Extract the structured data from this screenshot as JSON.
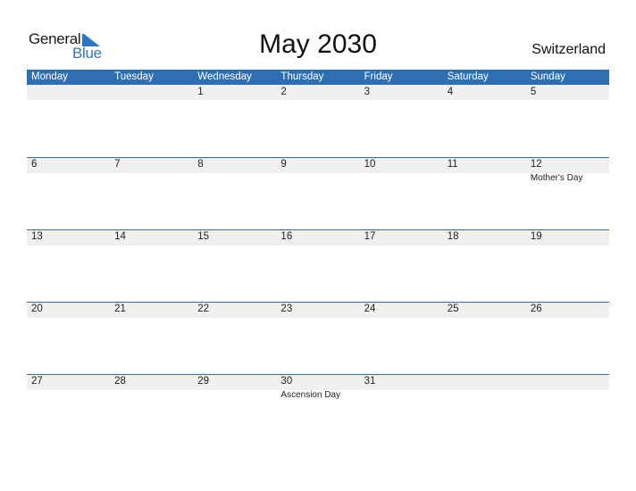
{
  "logo": {
    "word1": "General",
    "word2": "Blue"
  },
  "title": "May 2030",
  "country": "Switzerland",
  "colors": {
    "header_bg": "#2e6fb3",
    "logo_blue": "#2e77c0",
    "day_strip": "#f0f0f0"
  },
  "weekdays": [
    "Monday",
    "Tuesday",
    "Wednesday",
    "Thursday",
    "Friday",
    "Saturday",
    "Sunday"
  ],
  "weeks": [
    {
      "days": [
        {
          "num": "",
          "event": ""
        },
        {
          "num": "",
          "event": ""
        },
        {
          "num": "1",
          "event": ""
        },
        {
          "num": "2",
          "event": ""
        },
        {
          "num": "3",
          "event": ""
        },
        {
          "num": "4",
          "event": ""
        },
        {
          "num": "5",
          "event": ""
        }
      ]
    },
    {
      "days": [
        {
          "num": "6",
          "event": ""
        },
        {
          "num": "7",
          "event": ""
        },
        {
          "num": "8",
          "event": ""
        },
        {
          "num": "9",
          "event": ""
        },
        {
          "num": "10",
          "event": ""
        },
        {
          "num": "11",
          "event": ""
        },
        {
          "num": "12",
          "event": "Mother's Day"
        }
      ]
    },
    {
      "days": [
        {
          "num": "13",
          "event": ""
        },
        {
          "num": "14",
          "event": ""
        },
        {
          "num": "15",
          "event": ""
        },
        {
          "num": "16",
          "event": ""
        },
        {
          "num": "17",
          "event": ""
        },
        {
          "num": "18",
          "event": ""
        },
        {
          "num": "19",
          "event": ""
        }
      ]
    },
    {
      "days": [
        {
          "num": "20",
          "event": ""
        },
        {
          "num": "21",
          "event": ""
        },
        {
          "num": "22",
          "event": ""
        },
        {
          "num": "23",
          "event": ""
        },
        {
          "num": "24",
          "event": ""
        },
        {
          "num": "25",
          "event": ""
        },
        {
          "num": "26",
          "event": ""
        }
      ]
    },
    {
      "days": [
        {
          "num": "27",
          "event": ""
        },
        {
          "num": "28",
          "event": ""
        },
        {
          "num": "29",
          "event": ""
        },
        {
          "num": "30",
          "event": "Ascension Day"
        },
        {
          "num": "31",
          "event": ""
        },
        {
          "num": "",
          "event": ""
        },
        {
          "num": "",
          "event": ""
        }
      ]
    }
  ]
}
